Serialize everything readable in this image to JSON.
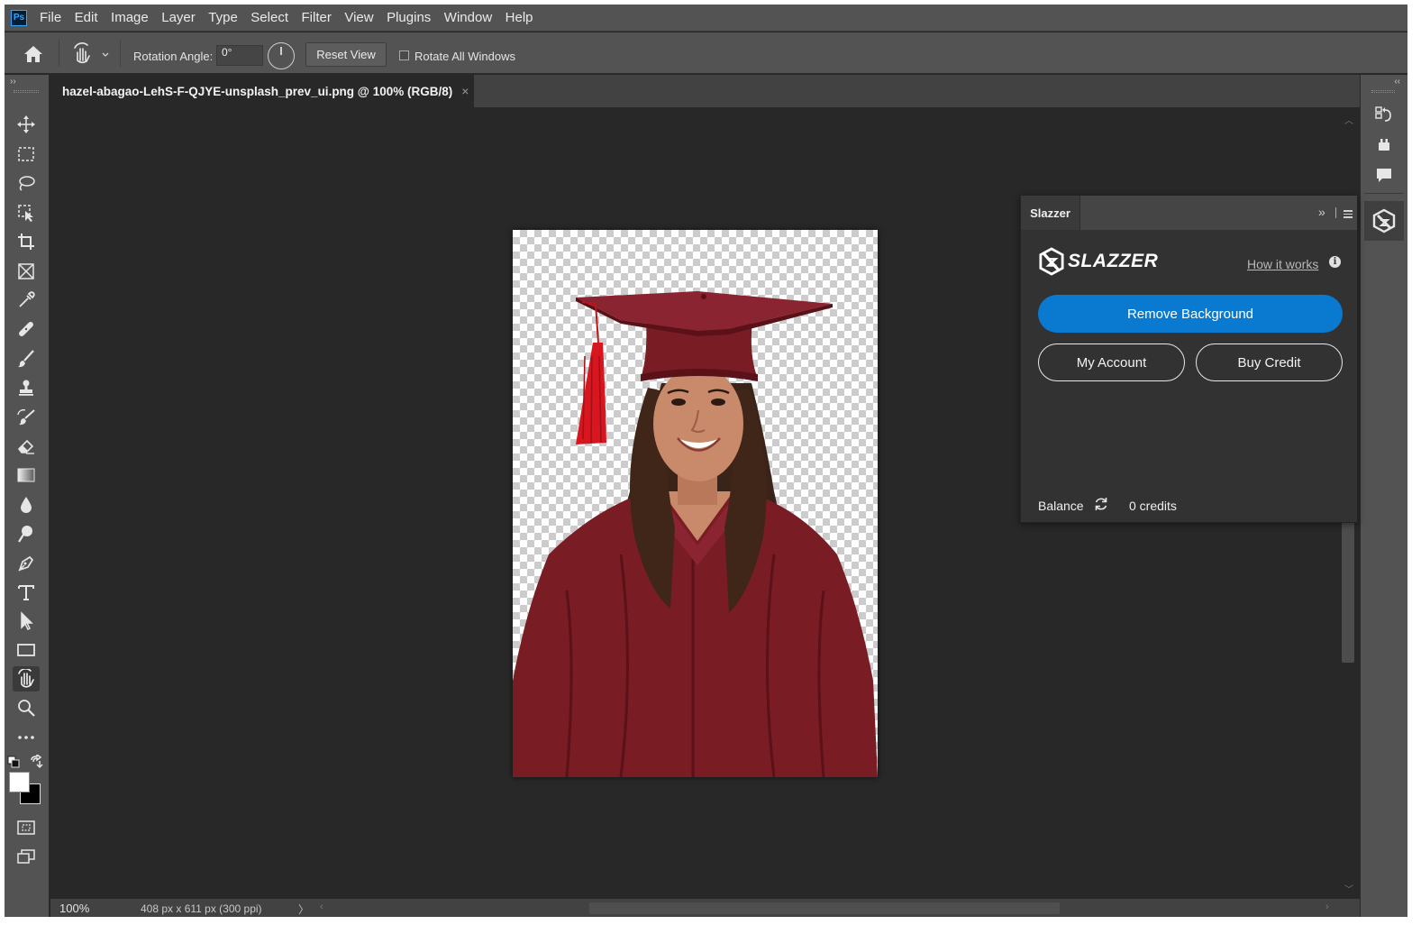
{
  "menubar": {
    "app_badge": "Ps",
    "items": [
      "File",
      "Edit",
      "Image",
      "Layer",
      "Type",
      "Select",
      "Filter",
      "View",
      "Plugins",
      "Window",
      "Help"
    ]
  },
  "options": {
    "rotation_label": "Rotation Angle:",
    "rotation_value": "0°",
    "reset_view": "Reset View",
    "rotate_all_windows": "Rotate All Windows"
  },
  "document": {
    "tab_title": "hazel-abagao-LehS-F-QJYE-unsplash_prev_ui.png @ 100% (RGB/8)",
    "close_glyph": "×"
  },
  "status": {
    "zoom": "100%",
    "doc_info": "408 px x 611 px (300 ppi)",
    "arrow": "〉"
  },
  "colors": {
    "foreground": "#ffffff",
    "background": "#000000",
    "accent": "#0a7ad1",
    "gown": "#7a1c24"
  },
  "tools": [
    "move-icon",
    "marquee-icon",
    "lasso-icon",
    "object-select-icon",
    "crop-icon",
    "frame-icon",
    "eyedropper-icon",
    "healing-icon",
    "brush-icon",
    "stamp-icon",
    "history-brush-icon",
    "eraser-icon",
    "gradient-icon",
    "blur-icon",
    "dodge-icon",
    "pen-icon",
    "type-icon",
    "path-select-icon",
    "rectangle-icon",
    "hand-icon",
    "zoom-icon",
    "more-icon",
    "quick-mask-icon",
    "screen-mode-icon"
  ],
  "slazzer": {
    "tab": "Slazzer",
    "logo_text": "SLAZZER",
    "how_it_works": "How it works",
    "info_glyph": "i",
    "remove_background": "Remove Background",
    "my_account": "My Account",
    "buy_credit": "Buy Credit",
    "balance_label": "Balance",
    "credits": "0 credits"
  }
}
